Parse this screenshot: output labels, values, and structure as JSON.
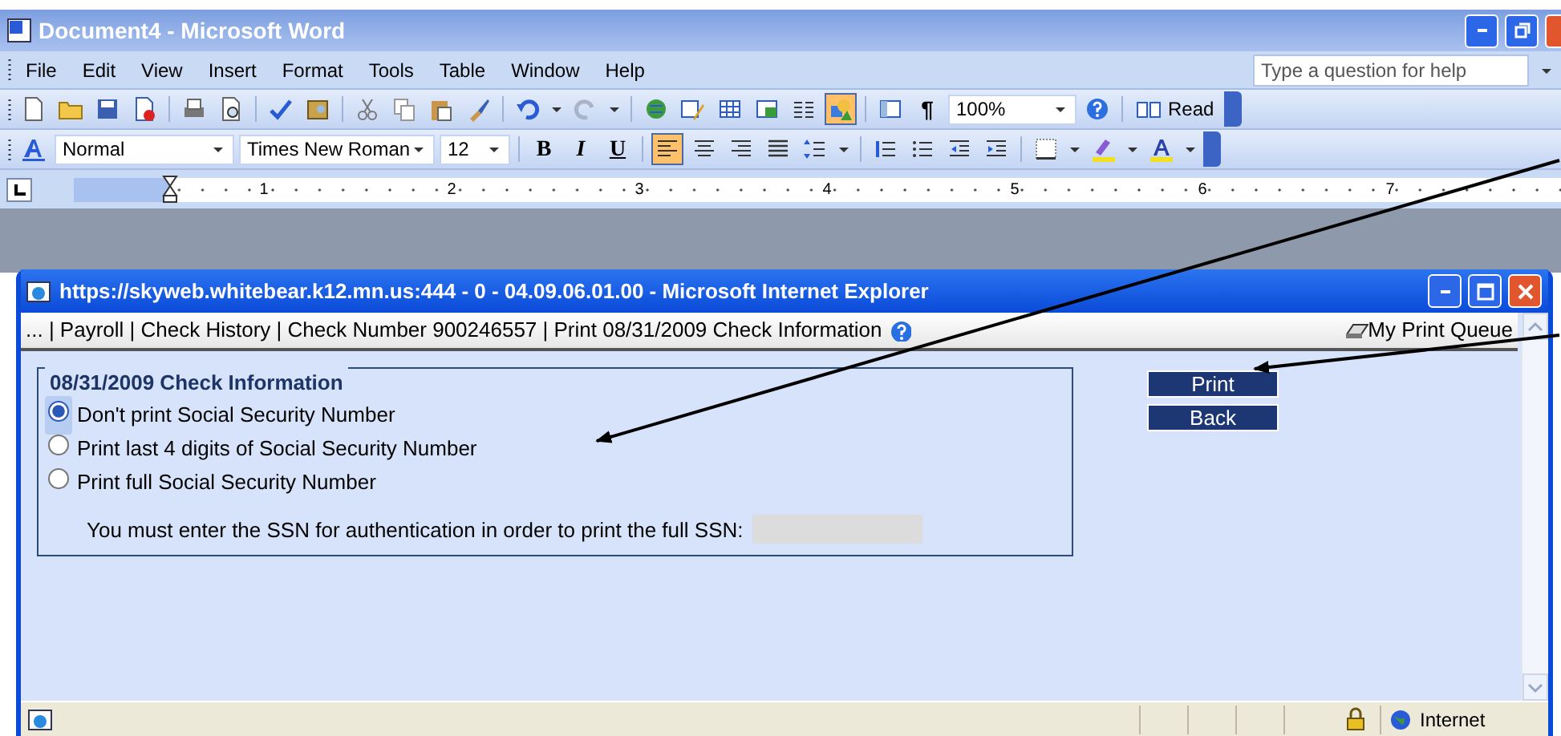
{
  "word_window": {
    "title": "Document4 - Microsoft Word",
    "menu": [
      "File",
      "Edit",
      "View",
      "Insert",
      "Format",
      "Tools",
      "Table",
      "Window",
      "Help"
    ],
    "help_box": {
      "placeholder": "Type a question for help"
    },
    "standard_toolbar": {
      "drawing_selected": true,
      "pilcrow": "¶",
      "zoom": "100%",
      "read": "Read"
    },
    "formatting_toolbar": {
      "style": "Normal",
      "font": "Times New Roman",
      "size": "12",
      "bold": "B",
      "italic": "I",
      "underline": "U",
      "align_left_selected": true
    },
    "ruler": [
      "1",
      "2",
      "3",
      "4",
      "5",
      "6",
      "7"
    ]
  },
  "ie_window": {
    "title": "https://skyweb.whitebear.k12.mn.us:444 - 0 - 04.09.06.01.00 - Microsoft Internet Explorer",
    "breadcrumb": "... | Payroll | Check History | Check Number 900246557 | Print 08/31/2009 Check Information",
    "print_queue": "My Print Queue",
    "legend": "08/31/2009 Check Information",
    "options": [
      {
        "label": "Don't print Social Security Number",
        "selected": true
      },
      {
        "label": "Print last 4 digits of Social Security Number",
        "selected": false
      },
      {
        "label": "Print full Social Security Number",
        "selected": false
      }
    ],
    "ssn_prompt": "You must enter the SSN for authentication in order to print the full SSN:",
    "buttons": [
      "Print",
      "Back"
    ],
    "status_zone": "Internet"
  }
}
